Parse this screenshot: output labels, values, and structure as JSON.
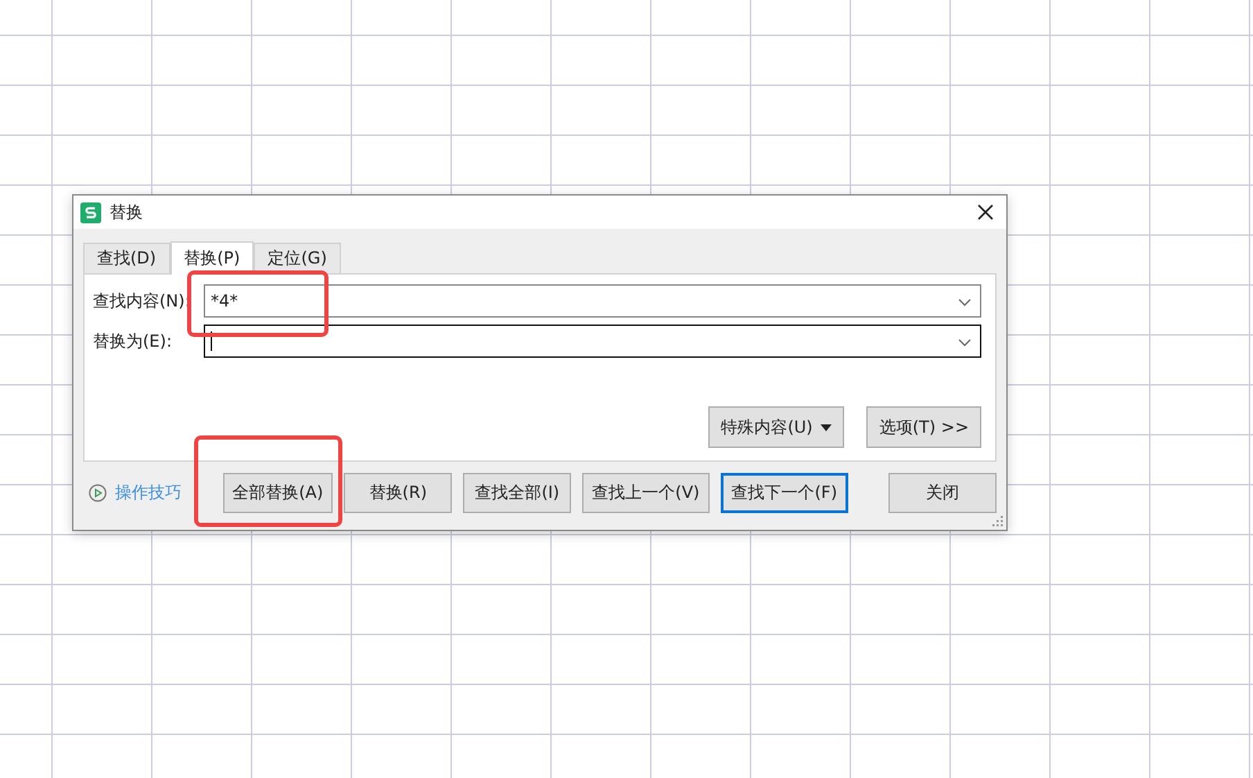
{
  "window": {
    "title": "替换"
  },
  "tabs": [
    {
      "label": "查找(D)",
      "selected": false
    },
    {
      "label": "替换(P)",
      "selected": true
    },
    {
      "label": "定位(G)",
      "selected": false
    }
  ],
  "fields": [
    {
      "label": "查找内容(N):",
      "value": "*4*",
      "focused": false
    },
    {
      "label": "替换为(E):",
      "focused": true
    }
  ],
  "option_buttons": [
    {
      "label": "特殊内容(U)",
      "kind": "dropdown"
    },
    {
      "label": "选项(T) >>",
      "kind": "plain"
    }
  ],
  "tips_link": "操作技巧",
  "buttons": [
    {
      "label": "全部替换(A)",
      "default": false,
      "annotated": true
    },
    {
      "label": "替换(R)",
      "default": false,
      "annotated": false
    },
    {
      "label": "查找全部(I)",
      "default": false,
      "annotated": false
    },
    {
      "label": "查找上一个(V)",
      "default": false,
      "annotated": false
    },
    {
      "label": "查找下一个(F)",
      "default": true,
      "annotated": false
    }
  ],
  "close_button": "关闭",
  "annotations": [
    {
      "kind": "find-field"
    }
  ]
}
